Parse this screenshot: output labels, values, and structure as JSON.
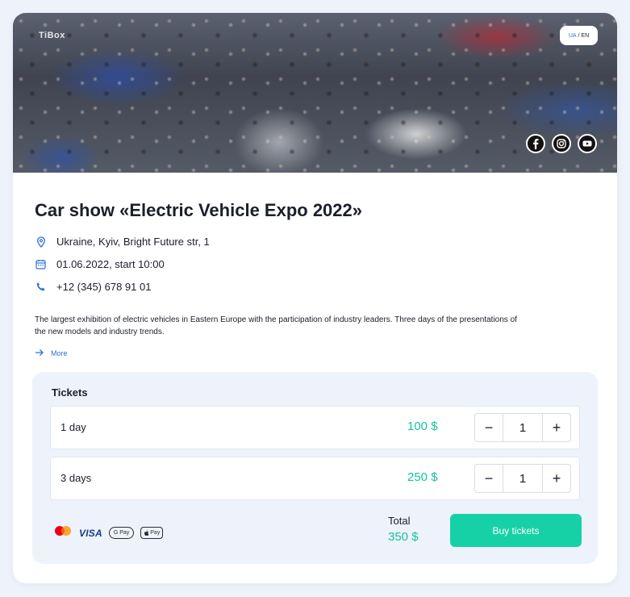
{
  "hero": {
    "logo_text": "TiBox",
    "lang": {
      "ua": "UA",
      "separator": " / ",
      "en": "EN"
    },
    "social_icons": [
      "facebook-icon",
      "instagram-icon",
      "youtube-icon"
    ]
  },
  "event": {
    "title": "Car show «Electric Vehicle Expo 2022»",
    "location": "Ukraine, Kyiv, Bright Future str, 1",
    "date": "01.06.2022, start 10:00",
    "phone": "+12 (345) 678 91 01",
    "description": "The largest exhibition of electric vehicles in Eastern Europe with the participation of industry leaders. Three days of the presentations of the new models and industry trends.",
    "more_label": "More"
  },
  "tickets": {
    "title": "Tickets",
    "items": [
      {
        "name": "1 day",
        "price": "100 $",
        "qty": "1"
      },
      {
        "name": "3 days",
        "price": "250 $",
        "qty": "1"
      }
    ],
    "minus_symbol": "−",
    "plus_symbol": "+",
    "payments": {
      "visa": "VISA",
      "gpay": "G Pay",
      "apay": "Pay"
    },
    "total_label": "Total",
    "total_value": "350 $",
    "buy_label": "Buy tickets"
  },
  "colors": {
    "accent": "#17d1a6",
    "price": "#17c3a0",
    "link": "#2d6fd6",
    "background": "#eef2fa"
  }
}
